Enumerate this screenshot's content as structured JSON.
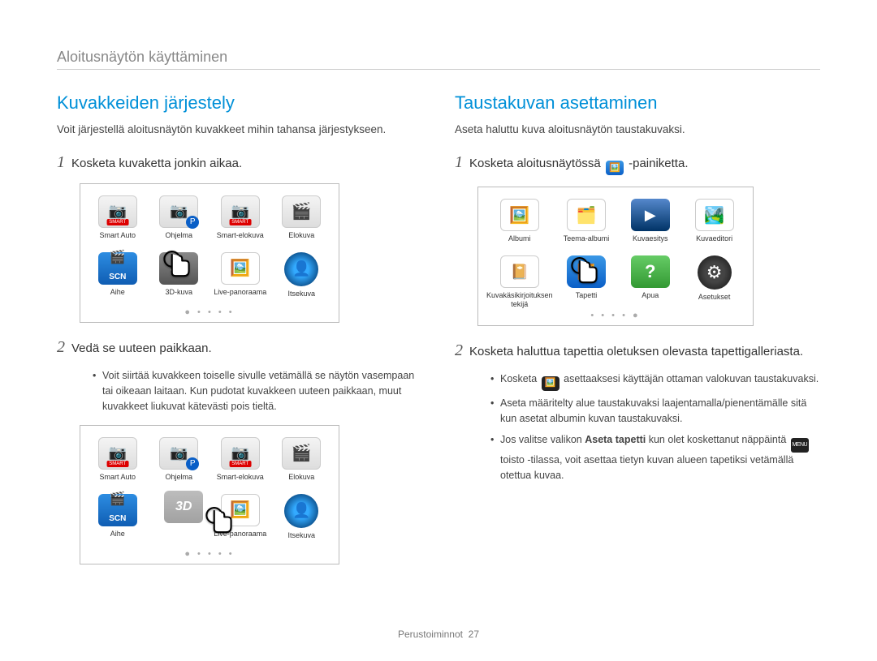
{
  "breadcrumb": "Aloitusnäytön käyttäminen",
  "left": {
    "title": "Kuvakkeiden järjestely",
    "sub": "Voit järjestellä aloitusnäytön kuvakkeet mihin tahansa järjestykseen.",
    "step1": "Kosketa kuvaketta jonkin aikaa.",
    "step2": "Vedä se uuteen paikkaan.",
    "bullet1": "Voit siirtää kuvakkeen toiselle sivulle vetämällä se näytön vasempaan tai oikeaan laitaan. Kun pudotat kuvakkeen uuteen paikkaan, muut kuvakkeet liukuvat kätevästi pois tieltä.",
    "icons1": [
      {
        "label": "Smart Auto",
        "cls": "ic-smart"
      },
      {
        "label": "Ohjelma",
        "cls": "ic-p"
      },
      {
        "label": "Smart-elokuva",
        "cls": "ic-smart"
      },
      {
        "label": "Elokuva",
        "cls": "ic-video"
      },
      {
        "label": "Aihe",
        "cls": "ic-scn"
      },
      {
        "label": "3D-kuva",
        "cls": "ic-3d"
      },
      {
        "label": "Live-panoraama",
        "cls": "ic-pano"
      },
      {
        "label": "Itsekuva",
        "cls": "ic-self"
      }
    ],
    "icons2": [
      {
        "label": "Smart Auto",
        "cls": "ic-smart"
      },
      {
        "label": "Ohjelma",
        "cls": "ic-p"
      },
      {
        "label": "Smart-elokuva",
        "cls": "ic-smart"
      },
      {
        "label": "Elokuva",
        "cls": "ic-video"
      },
      {
        "label": "Aihe",
        "cls": "ic-scn"
      },
      {
        "label": "",
        "cls": "ic-3d ghost"
      },
      {
        "label": "Live-panoraama",
        "cls": "ic-pano"
      },
      {
        "label": "Itsekuva",
        "cls": "ic-self"
      }
    ]
  },
  "right": {
    "title": "Taustakuvan asettaminen",
    "sub": "Aseta haluttu kuva aloitusnäytön taustakuvaksi.",
    "step1_pre": "Kosketa aloitusnäytössä ",
    "step1_post": " -painiketta.",
    "step2": "Kosketa haluttua tapettia oletuksen olevasta tapettigalleriasta.",
    "icons": [
      {
        "label": "Albumi",
        "cls": "ic-album"
      },
      {
        "label": "Teema-albumi",
        "cls": "ic-theme"
      },
      {
        "label": "Kuvaesitys",
        "cls": "ic-slide"
      },
      {
        "label": "Kuvaeditori",
        "cls": "ic-edit"
      },
      {
        "label": "Kuvakäsikirjoituksen tekijä",
        "cls": "ic-story"
      },
      {
        "label": "Tapetti",
        "cls": "ic-wall"
      },
      {
        "label": "Apua",
        "cls": "ic-help"
      },
      {
        "label": "Asetukset",
        "cls": "ic-set"
      }
    ],
    "bullet1_pre": "Kosketa ",
    "bullet1_post": " asettaaksesi käyttäjän ottaman valokuvan taustakuvaksi.",
    "bullet2": "Aseta määritelty alue taustakuvaksi laajentamalla/pienentämälle sitä kun asetat albumin kuvan taustakuvaksi.",
    "bullet3_pre": "Jos valitse valikon ",
    "bullet3_bold": "Aseta tapetti",
    "bullet3_mid": " kun olet koskettanut näppäintä ",
    "bullet3_menu": "MENU",
    "bullet3_post": " toisto -tilassa, voit asettaa tietyn kuvan alueen tapetiksi vetämällä otettua kuvaa."
  },
  "footer": {
    "label": "Perustoiminnot",
    "page": "27"
  }
}
